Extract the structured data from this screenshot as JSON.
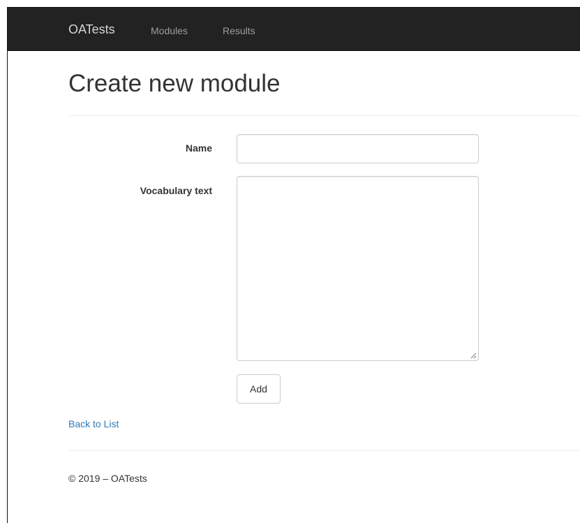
{
  "navbar": {
    "brand": "OATests",
    "links": [
      "Modules",
      "Results"
    ]
  },
  "page": {
    "title": "Create new module"
  },
  "form": {
    "name_label": "Name",
    "name_value": "",
    "vocab_label": "Vocabulary text",
    "vocab_value": "",
    "submit_label": "Add"
  },
  "back_link": "Back to List",
  "footer": {
    "text": "© 2019 – OATests"
  },
  "colors": {
    "navbar_bg": "#222222",
    "link": "#337ab7",
    "text": "#333333"
  }
}
